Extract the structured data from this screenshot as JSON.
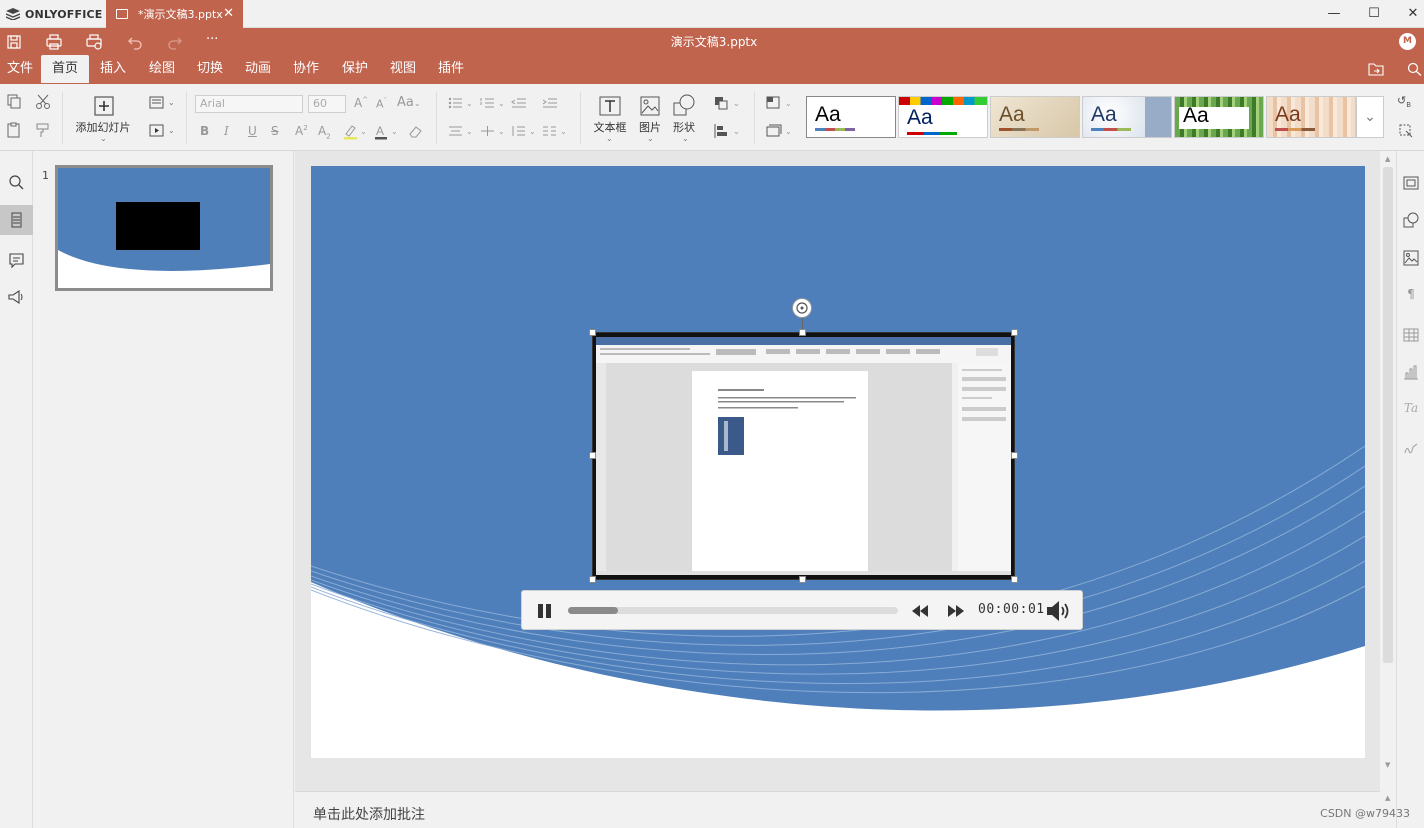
{
  "app": {
    "brand": "ONLYOFFICE",
    "tab_title": "*演示文稿3.pptx",
    "doc_title": "演示文稿3.pptx",
    "user_initial": "M",
    "accent_color": "#c0644e"
  },
  "window_controls": {
    "minimize": "—",
    "maximize": "☐",
    "close": "✕"
  },
  "menu": {
    "tabs": [
      {
        "label": "文件"
      },
      {
        "label": "首页"
      },
      {
        "label": "插入"
      },
      {
        "label": "绘图"
      },
      {
        "label": "切换"
      },
      {
        "label": "动画"
      },
      {
        "label": "协作"
      },
      {
        "label": "保护"
      },
      {
        "label": "视图"
      },
      {
        "label": "插件"
      }
    ],
    "active_tab": "首页"
  },
  "toolbar": {
    "add_slide_label": "添加幻灯片",
    "font_name": "Arial",
    "font_size": "60",
    "textbox_label": "文本框",
    "image_label": "图片",
    "shape_label": "形状",
    "themes_aa": "Aa"
  },
  "slides_panel": {
    "slide_number": "1"
  },
  "player": {
    "time": "00:00:01",
    "progress_fraction": 0.15
  },
  "notes": {
    "placeholder": "单击此处添加批注"
  },
  "watermark": "CSDN @w79433",
  "icons": [
    "save-icon",
    "print-icon",
    "quick-print-icon",
    "undo-icon",
    "redo-icon",
    "more-icon",
    "copy-icon",
    "cut-icon",
    "paste-icon",
    "format-painter-icon",
    "search-icon",
    "slides-icon",
    "comments-icon",
    "feedback-icon",
    "pause-icon",
    "rewind-icon",
    "forward-icon",
    "volume-icon",
    "rotate-icon"
  ]
}
